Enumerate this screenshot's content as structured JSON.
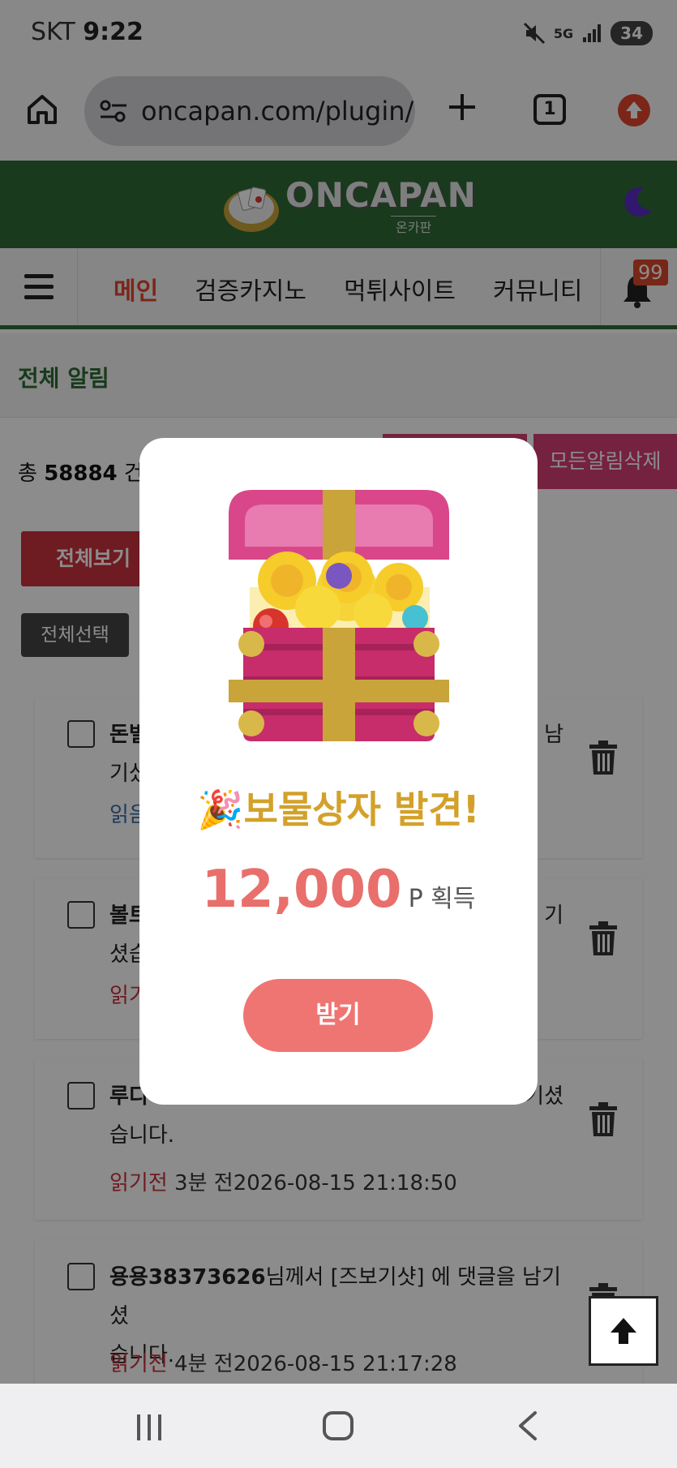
{
  "status_bar": {
    "carrier": "SKT",
    "time": "9:22",
    "network": "5G",
    "battery": "34"
  },
  "browser": {
    "url": "oncapan.com/plugin/",
    "tab_count": "1"
  },
  "site": {
    "logo_text": "ONCAPAN",
    "logo_subtext": "온카판",
    "brand_color": "#2f6a36"
  },
  "nav": {
    "items": [
      "메인",
      "검증카지노",
      "먹튀사이트",
      "커뮤니티"
    ],
    "notification_count": "99"
  },
  "page": {
    "title": "전체 알림",
    "total_prefix": "총",
    "total_count": "58884",
    "total_suffix": "건,",
    "delete_all_label": "모든알림삭제",
    "view_all_label": "전체보기",
    "select_all_label": "전체선택"
  },
  "notifications": [
    {
      "user": "돈벌",
      "line1_tail": "남",
      "line2": "기셨",
      "status": "읽음"
    },
    {
      "user": "볼트",
      "line1_tail": "기",
      "line2": "셨습",
      "status": "읽기"
    },
    {
      "user": "루디",
      "line1_tail": "기셨",
      "line2": "습니다.",
      "status": "읽기전",
      "time_ago": "3분 전",
      "datetime": "2026-08-15 21:18:50"
    },
    {
      "user": "용용38373626",
      "line1_tail": "님께서 [즈보기샷] 에 댓글을 남기셨",
      "line2": "습니다.",
      "status": "읽기전",
      "time_ago": "4분 전",
      "datetime": "2026-08-15 21:17:28"
    }
  ],
  "modal": {
    "title": "🎉보물상자 발견!",
    "amount": "12,000",
    "unit": "P 획득",
    "button": "받기"
  }
}
